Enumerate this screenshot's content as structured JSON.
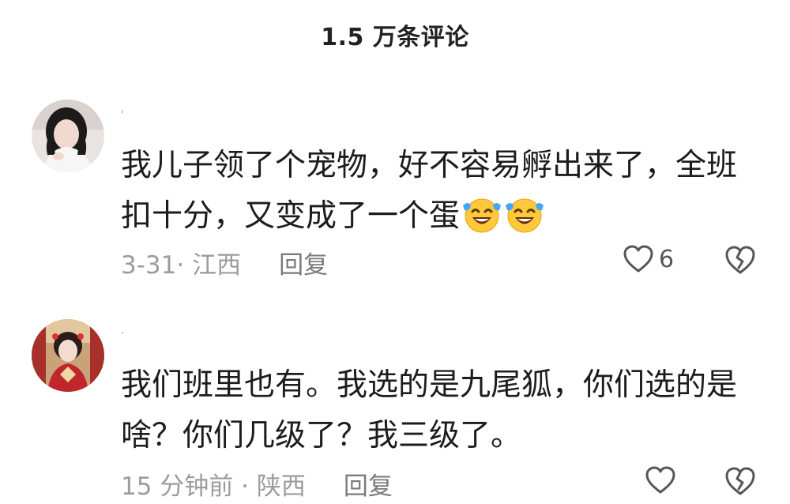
{
  "header": {
    "title": "1.5 万条评论"
  },
  "comments": [
    {
      "username": "'",
      "text": "我儿子领了个宠物，好不容易孵出来了，全班扣十分，又变成了一个蛋",
      "emoji": [
        "laughing-tears-emoji",
        "laughing-tears-emoji"
      ],
      "time_location": "3-31· 江西",
      "reply_label": "回复",
      "like_count": "6"
    },
    {
      "username": "·",
      "text": "我们班里也有。我选的是九尾狐，你们选的是啥？你们几级了？我三级了。",
      "time_location": "15 分钟前 · 陕西",
      "reply_label": "回复",
      "like_count": ""
    }
  ],
  "colors": {
    "text": "#1c1c1c",
    "meta": "#9c9c9c",
    "icon": "#555555",
    "emoji_face": "#ffc83d",
    "emoji_tear": "#3fa7ff"
  }
}
